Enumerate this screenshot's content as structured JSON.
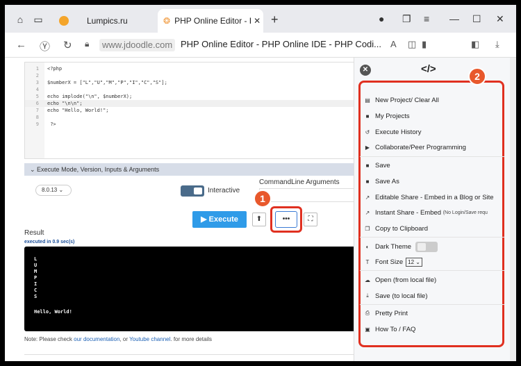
{
  "browser": {
    "tabs": [
      {
        "label": "Lumpics.ru",
        "active": false
      },
      {
        "label": "PHP Online Editor - PHP",
        "active": true
      }
    ],
    "url": "www.jdoodle.com",
    "page_title": "PHP Online Editor - PHP Online IDE - PHP Codi..."
  },
  "editor": {
    "lines": [
      {
        "n": "1",
        "text": "<?php"
      },
      {
        "n": "2",
        "text": ""
      },
      {
        "n": "3",
        "text": "$numberX = [\"L\",\"U\",\"M\",\"P\",\"I\",\"C\",\"S\"];"
      },
      {
        "n": "4",
        "text": ""
      },
      {
        "n": "5",
        "text": "echo implode(\"\\n\", $numberX);"
      },
      {
        "n": "6",
        "text": "echo \"\\n\\n\";"
      },
      {
        "n": "7",
        "text": "echo \"Hello, World!\";"
      },
      {
        "n": "8",
        "text": ""
      },
      {
        "n": "9",
        "text": " ?>"
      }
    ]
  },
  "settings": {
    "accordion_label": "Execute Mode, Version, Inputs & Arguments",
    "version": "8.0.13",
    "interactive_label": "Interactive",
    "cmd_args_label": "CommandLine Arguments"
  },
  "actions": {
    "execute_label": "Execute",
    "more_label": "•••"
  },
  "result": {
    "label": "Result",
    "executed": "executed in 0.9 sec(s)",
    "output": [
      "L",
      "U",
      "M",
      "P",
      "I",
      "C",
      "S",
      "",
      "Hello, World!"
    ],
    "note_prefix": "Note: Please check ",
    "note_link1": "our documentation",
    "note_mid": ", or ",
    "note_link2": "Youtube channel",
    "note_suffix": ". for more details"
  },
  "panel": {
    "logo": "</>",
    "items": [
      {
        "label": "New Project/ Clear All",
        "icon": "file-icon"
      },
      {
        "label": "My Projects",
        "icon": "folder-icon"
      },
      {
        "label": "Execute History",
        "icon": "history-icon"
      },
      {
        "label": "Collaborate/Peer Programming",
        "icon": "video-icon"
      },
      {
        "label": "Save",
        "icon": "folder-icon"
      },
      {
        "label": "Save As",
        "icon": "folder-icon"
      },
      {
        "label": "Editable Share - Embed in a Blog or Site",
        "icon": "share-icon"
      },
      {
        "label": "Instant Share - Embed",
        "small": "(No Login/Save requ",
        "icon": "share-icon"
      },
      {
        "label": "Copy to Clipboard",
        "icon": "copy-icon"
      },
      {
        "label": "Dark Theme",
        "icon": "moon-icon"
      },
      {
        "label": "Font Size",
        "value": "12",
        "icon": "font-icon"
      },
      {
        "label": "Open (from local file)",
        "icon": "upload-icon"
      },
      {
        "label": "Save (to local file)",
        "icon": "download-icon"
      },
      {
        "label": "Pretty Print",
        "icon": "print-icon"
      },
      {
        "label": "How To / FAQ",
        "icon": "book-icon"
      }
    ]
  },
  "annotations": {
    "badge1": "1",
    "badge2": "2"
  }
}
